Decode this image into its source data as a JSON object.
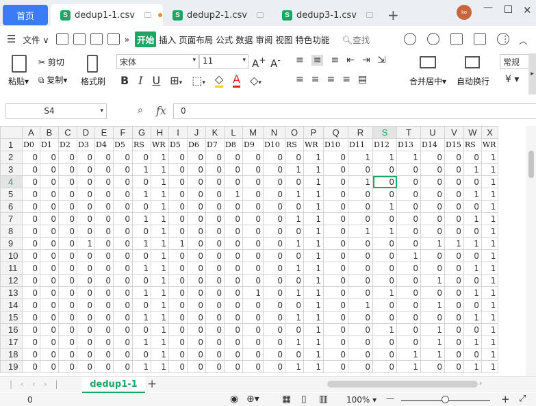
{
  "tabs": {
    "home": "首页",
    "docs": [
      "dedup1-1.csv",
      "dedup2-1.csv",
      "dedup3-1.csv"
    ],
    "avatar": "ko"
  },
  "menu": {
    "file": "文件",
    "items": [
      "开始",
      "插入",
      "页面布局",
      "公式",
      "数据",
      "审阅",
      "视图",
      "特色功能"
    ],
    "search": "查找"
  },
  "ribbon": {
    "paste": "粘贴",
    "cut": "剪切",
    "copy": "复制",
    "format_painter": "格式刷",
    "font": "宋体",
    "size": "11",
    "merge": "合并居中",
    "wrap": "自动换行",
    "number_format": "常规"
  },
  "formula_bar": {
    "cell_ref": "S4",
    "value": "0"
  },
  "columns": [
    "A",
    "B",
    "C",
    "D",
    "E",
    "F",
    "G",
    "H",
    "I",
    "J",
    "K",
    "L",
    "M",
    "N",
    "O",
    "P",
    "Q",
    "R",
    "S",
    "T",
    "U",
    "V",
    "W",
    "X"
  ],
  "header_row": [
    "D0",
    "D1",
    "D2",
    "D3",
    "D4",
    "D5",
    "RS",
    "WR",
    "D5",
    "D6",
    "D7",
    "D8",
    "D9",
    "D10",
    "RS",
    "WR",
    "D10",
    "D11",
    "D12",
    "D13",
    "D14",
    "D15",
    "RS",
    "WR"
  ],
  "rows": [
    [
      "0",
      "0",
      "0",
      "0",
      "0",
      "0",
      "0",
      "1",
      "0",
      "0",
      "0",
      "0",
      "0",
      "0",
      "0",
      "1",
      "0",
      "1",
      "1",
      "1",
      "0",
      "0",
      "0",
      "1"
    ],
    [
      "0",
      "0",
      "0",
      "0",
      "0",
      "0",
      "1",
      "1",
      "0",
      "0",
      "0",
      "0",
      "0",
      "0",
      "1",
      "1",
      "0",
      "0",
      "0",
      "0",
      "0",
      "0",
      "1",
      "1"
    ],
    [
      "0",
      "0",
      "0",
      "0",
      "0",
      "0",
      "0",
      "1",
      "0",
      "0",
      "0",
      "0",
      "0",
      "0",
      "0",
      "1",
      "0",
      "1",
      "0",
      "0",
      "0",
      "0",
      "0",
      "1"
    ],
    [
      "0",
      "0",
      "0",
      "0",
      "0",
      "0",
      "1",
      "1",
      "0",
      "0",
      "0",
      "1",
      "0",
      "0",
      "1",
      "1",
      "0",
      "0",
      "0",
      "0",
      "0",
      "0",
      "1",
      "1"
    ],
    [
      "0",
      "0",
      "0",
      "0",
      "0",
      "0",
      "0",
      "1",
      "0",
      "0",
      "0",
      "0",
      "0",
      "0",
      "0",
      "1",
      "0",
      "0",
      "1",
      "0",
      "0",
      "0",
      "0",
      "1"
    ],
    [
      "0",
      "0",
      "0",
      "0",
      "0",
      "0",
      "1",
      "1",
      "0",
      "0",
      "0",
      "0",
      "0",
      "0",
      "1",
      "1",
      "0",
      "0",
      "0",
      "0",
      "0",
      "0",
      "1",
      "1"
    ],
    [
      "0",
      "0",
      "0",
      "0",
      "0",
      "0",
      "0",
      "1",
      "0",
      "0",
      "0",
      "0",
      "0",
      "0",
      "0",
      "1",
      "0",
      "1",
      "1",
      "0",
      "0",
      "0",
      "0",
      "1"
    ],
    [
      "0",
      "0",
      "0",
      "1",
      "0",
      "0",
      "1",
      "1",
      "1",
      "0",
      "0",
      "0",
      "0",
      "0",
      "1",
      "1",
      "0",
      "0",
      "0",
      "0",
      "1",
      "1",
      "1",
      "1"
    ],
    [
      "0",
      "0",
      "0",
      "0",
      "0",
      "0",
      "0",
      "1",
      "0",
      "0",
      "0",
      "0",
      "0",
      "0",
      "0",
      "1",
      "0",
      "0",
      "0",
      "1",
      "0",
      "0",
      "0",
      "1"
    ],
    [
      "0",
      "0",
      "0",
      "0",
      "0",
      "0",
      "1",
      "1",
      "0",
      "0",
      "0",
      "0",
      "0",
      "0",
      "1",
      "1",
      "0",
      "0",
      "0",
      "0",
      "0",
      "0",
      "1",
      "1"
    ],
    [
      "0",
      "0",
      "0",
      "0",
      "0",
      "0",
      "0",
      "1",
      "0",
      "0",
      "0",
      "0",
      "0",
      "0",
      "0",
      "1",
      "0",
      "0",
      "0",
      "0",
      "1",
      "0",
      "0",
      "1"
    ],
    [
      "0",
      "0",
      "0",
      "0",
      "0",
      "0",
      "1",
      "1",
      "0",
      "0",
      "0",
      "0",
      "1",
      "0",
      "1",
      "1",
      "0",
      "0",
      "1",
      "0",
      "0",
      "0",
      "1",
      "1"
    ],
    [
      "0",
      "0",
      "0",
      "0",
      "0",
      "0",
      "0",
      "1",
      "0",
      "0",
      "0",
      "0",
      "0",
      "0",
      "0",
      "1",
      "0",
      "1",
      "0",
      "0",
      "1",
      "0",
      "0",
      "1"
    ],
    [
      "0",
      "0",
      "0",
      "0",
      "0",
      "0",
      "1",
      "1",
      "0",
      "0",
      "0",
      "0",
      "0",
      "0",
      "1",
      "1",
      "0",
      "0",
      "0",
      "0",
      "0",
      "0",
      "1",
      "1"
    ],
    [
      "0",
      "0",
      "0",
      "0",
      "0",
      "0",
      "0",
      "1",
      "0",
      "0",
      "0",
      "0",
      "0",
      "0",
      "0",
      "1",
      "0",
      "0",
      "1",
      "0",
      "1",
      "0",
      "0",
      "1"
    ],
    [
      "0",
      "0",
      "0",
      "0",
      "0",
      "0",
      "1",
      "1",
      "0",
      "0",
      "0",
      "0",
      "0",
      "0",
      "1",
      "1",
      "0",
      "0",
      "0",
      "0",
      "1",
      "0",
      "1",
      "1"
    ],
    [
      "0",
      "0",
      "0",
      "0",
      "0",
      "0",
      "0",
      "1",
      "0",
      "0",
      "0",
      "0",
      "0",
      "0",
      "0",
      "1",
      "0",
      "0",
      "0",
      "1",
      "1",
      "0",
      "0",
      "1"
    ],
    [
      "0",
      "0",
      "0",
      "0",
      "0",
      "0",
      "1",
      "1",
      "0",
      "0",
      "0",
      "0",
      "0",
      "0",
      "1",
      "1",
      "0",
      "0",
      "0",
      "1",
      "0",
      "0",
      "1",
      "1"
    ]
  ],
  "active_col": "S",
  "active_row": "4",
  "sheet_tab": "dedup1-1",
  "status": {
    "value": "0",
    "zoom": "100%"
  },
  "accent": "#1aa765"
}
